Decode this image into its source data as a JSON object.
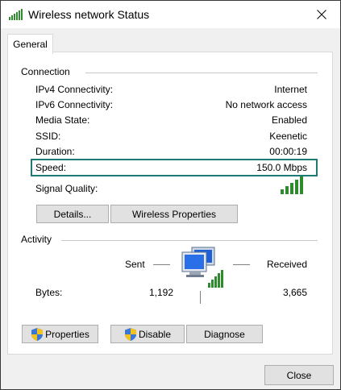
{
  "window": {
    "title": "Wireless network Status",
    "close_icon": "close-icon"
  },
  "tabs": [
    {
      "label": "General",
      "selected": true
    }
  ],
  "connection": {
    "heading": "Connection",
    "rows": [
      {
        "label": "IPv4 Connectivity:",
        "value": "Internet"
      },
      {
        "label": "IPv6 Connectivity:",
        "value": "No network access"
      },
      {
        "label": "Media State:",
        "value": "Enabled"
      },
      {
        "label": "SSID:",
        "value": "Keenetic"
      },
      {
        "label": "Duration:",
        "value": "00:00:19"
      },
      {
        "label": "Speed:",
        "value": "150.0 Mbps"
      }
    ],
    "signal_label": "Signal Quality:",
    "signal_bars": 5,
    "signal_color": "#2e8b2e",
    "highlight_color": "#1d7a74",
    "details_button": "Details...",
    "wireless_properties_button": "Wireless Properties"
  },
  "activity": {
    "heading": "Activity",
    "sent_label": "Sent",
    "received_label": "Received",
    "bytes_label": "Bytes:",
    "bytes_sent": "1,192",
    "bytes_received": "3,665",
    "network_icon": "network-computers-icon"
  },
  "actions": {
    "properties": "Properties",
    "disable": "Disable",
    "diagnose": "Diagnose",
    "shield_icon": "uac-shield-icon"
  },
  "footer": {
    "close": "Close"
  }
}
